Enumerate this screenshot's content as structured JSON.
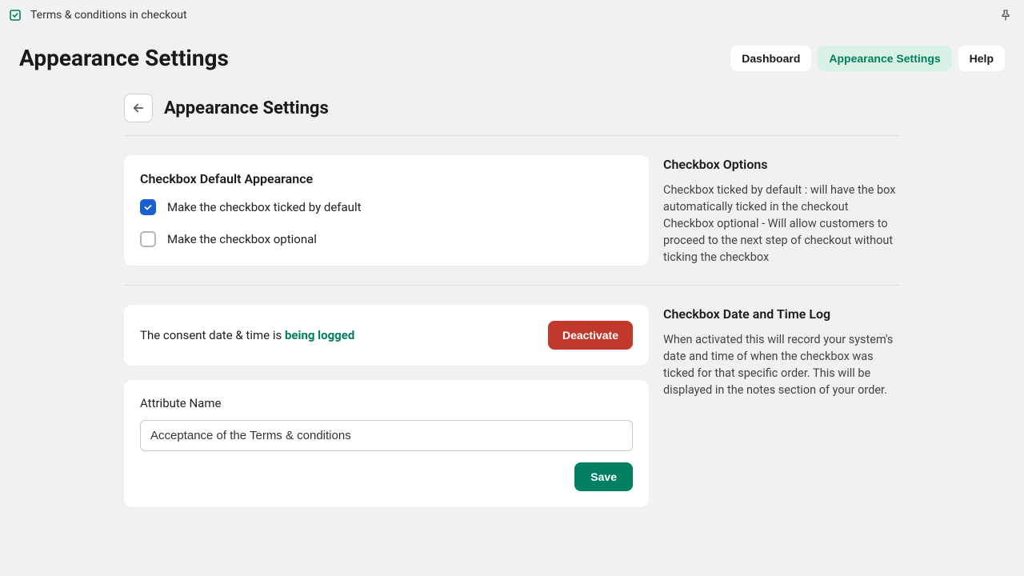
{
  "topbar": {
    "app_title": "Terms & conditions in checkout"
  },
  "header": {
    "page_title": "Appearance Settings",
    "tabs": {
      "dashboard": "Dashboard",
      "appearance": "Appearance Settings",
      "help": "Help"
    }
  },
  "subheader": {
    "title": "Appearance Settings"
  },
  "checkbox_card": {
    "title": "Checkbox Default Appearance",
    "options": {
      "ticked_default": {
        "label": "Make the checkbox ticked by default",
        "checked": true
      },
      "optional": {
        "label": "Make the checkbox optional",
        "checked": false
      }
    }
  },
  "checkbox_info": {
    "title": "Checkbox Options",
    "body": "Checkbox ticked by default : will have the box automatically ticked in the checkout Checkbox optional - Will allow customers to proceed to the next step of checkout without ticking the checkbox"
  },
  "consent_card": {
    "text_prefix": "The consent date & time is ",
    "text_status": "being logged",
    "deactivate_label": "Deactivate"
  },
  "attribute_card": {
    "label": "Attribute Name",
    "value": "Acceptance of the Terms & conditions",
    "save_label": "Save"
  },
  "log_info": {
    "title": "Checkbox Date and Time Log",
    "body": "When activated this will record your system's date and time of when the checkbox was ticked for that specific order. This will be displayed in the notes section of your order."
  },
  "colors": {
    "accent_green": "#008060",
    "danger_red": "#c0392b",
    "checkbox_blue": "#1a5fd0"
  }
}
